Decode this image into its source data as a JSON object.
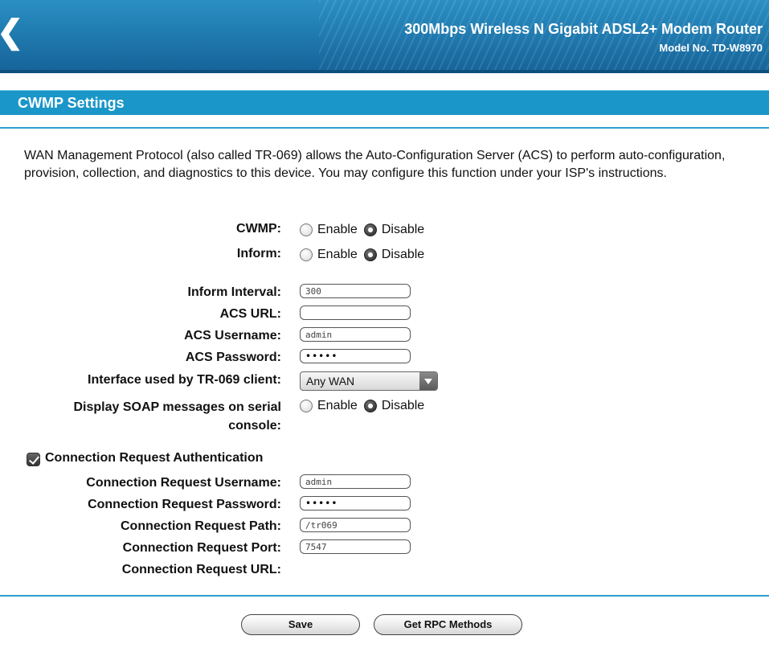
{
  "header": {
    "product_title": "300Mbps Wireless N Gigabit ADSL2+ Modem Router",
    "model_no": "Model No. TD-W8970",
    "logo_reg": "®"
  },
  "section_title": "CWMP Settings",
  "description": "WAN Management Protocol (also called TR-069) allows the Auto-Configuration Server (ACS) to perform auto-configuration, provision, collection, and diagnostics to this device. You may configure this function under your ISP's instructions.",
  "form": {
    "cwmp": {
      "label": "CWMP:",
      "enable": "Enable",
      "disable": "Disable",
      "selected": "Disable"
    },
    "inform": {
      "label": "Inform:",
      "enable": "Enable",
      "disable": "Disable",
      "selected": "Disable"
    },
    "inform_interval": {
      "label": "Inform Interval:",
      "value": "300"
    },
    "acs_url": {
      "label": "ACS URL:",
      "value": ""
    },
    "acs_username": {
      "label": "ACS Username:",
      "value": "admin"
    },
    "acs_password": {
      "label": "ACS Password:",
      "value": "•••••"
    },
    "interface": {
      "label": "Interface used by TR-069 client:",
      "value": "Any WAN"
    },
    "soap": {
      "label_line1": "Display SOAP messages on serial",
      "label_line2": "console:",
      "enable": "Enable",
      "disable": "Disable",
      "selected": "Disable"
    },
    "conn_auth": {
      "label": "Connection Request Authentication",
      "checked": true
    },
    "conn_username": {
      "label": "Connection Request Username:",
      "value": "admin"
    },
    "conn_password": {
      "label": "Connection Request Password:",
      "value": "•••••"
    },
    "conn_path": {
      "label": "Connection Request Path:",
      "value": "/tr069"
    },
    "conn_port": {
      "label": "Connection Request Port:",
      "value": "7547"
    },
    "conn_url": {
      "label": "Connection Request URL:",
      "value": ""
    }
  },
  "buttons": {
    "save": "Save",
    "get_rpc": "Get RPC Methods"
  },
  "colors": {
    "header": "#1f78ad",
    "section_bar": "#1b96c8",
    "rule": "#2a9fd0"
  }
}
